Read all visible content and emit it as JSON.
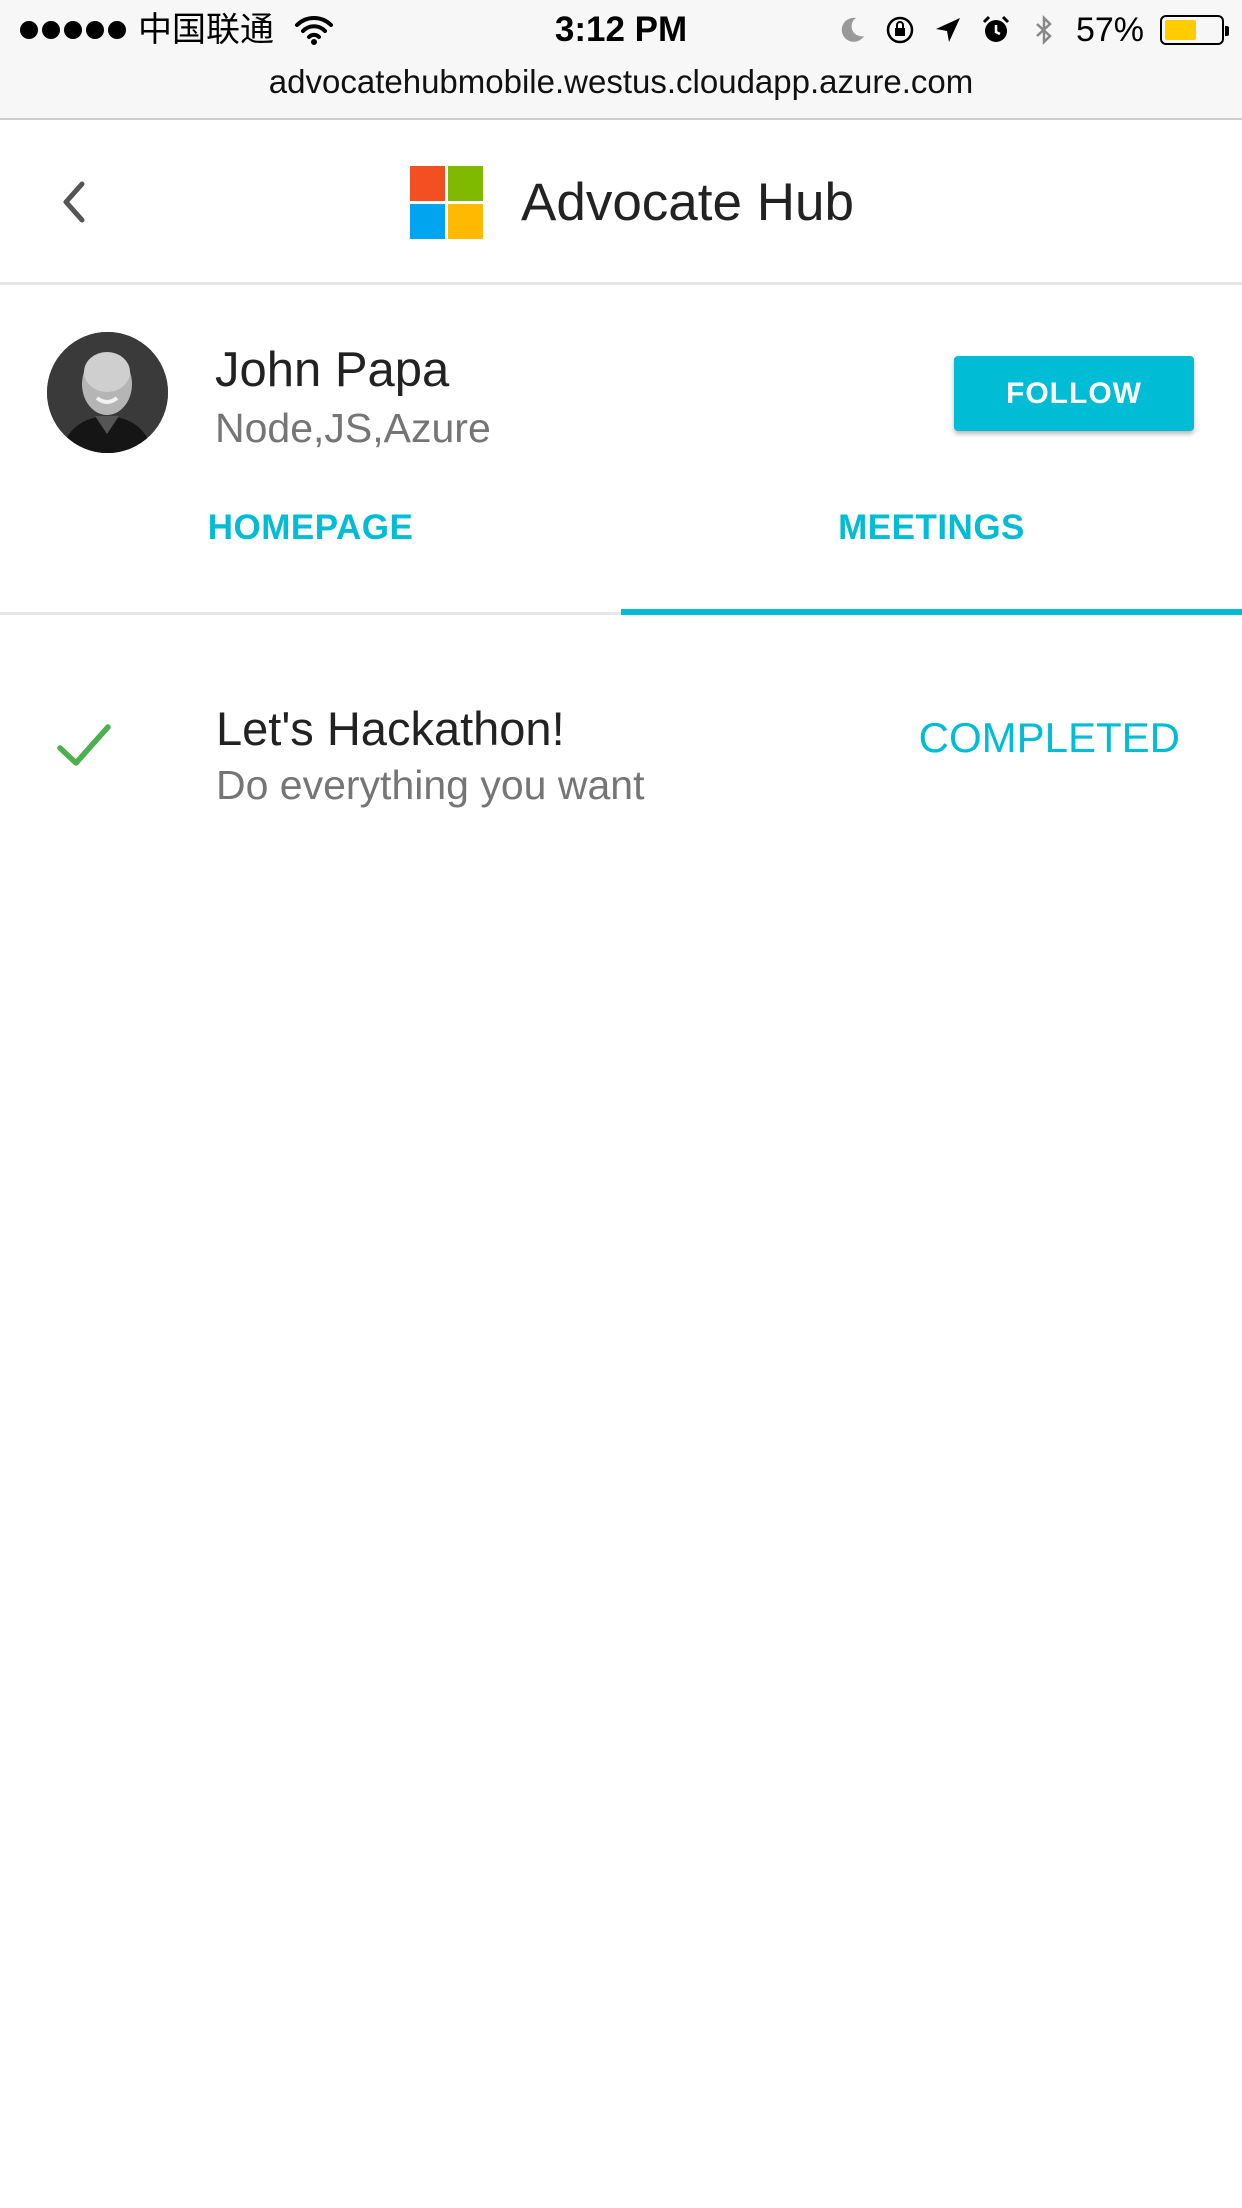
{
  "status_bar": {
    "carrier": "中国联通",
    "time": "3:12 PM",
    "battery_percent": "57%",
    "battery_level": 0.57,
    "battery_color": "#ffcc00",
    "icons": [
      "signal-dots-icon",
      "wifi-icon",
      "moon-icon",
      "orientation-lock-icon",
      "location-arrow-icon",
      "alarm-icon",
      "bluetooth-icon",
      "battery-icon"
    ]
  },
  "browser": {
    "url": "advocatehubmobile.westus.cloudapp.azure.com"
  },
  "header": {
    "title": "Advocate Hub",
    "logo_colors": [
      "#f25022",
      "#7fba00",
      "#00a4ef",
      "#ffb900"
    ]
  },
  "profile": {
    "name": "John Papa",
    "tags": "Node,JS,Azure",
    "follow_label": "FOLLOW"
  },
  "tabs": [
    {
      "label": "HOMEPAGE",
      "active": false
    },
    {
      "label": "MEETINGS",
      "active": true
    }
  ],
  "meetings": [
    {
      "title": "Let's Hackathon!",
      "description": "Do everything you want",
      "status": "COMPLETED",
      "icon": "checkmark-icon"
    }
  ],
  "colors": {
    "accent": "#00bcd4",
    "check": "#4caf50",
    "secondary_text": "#757575"
  }
}
